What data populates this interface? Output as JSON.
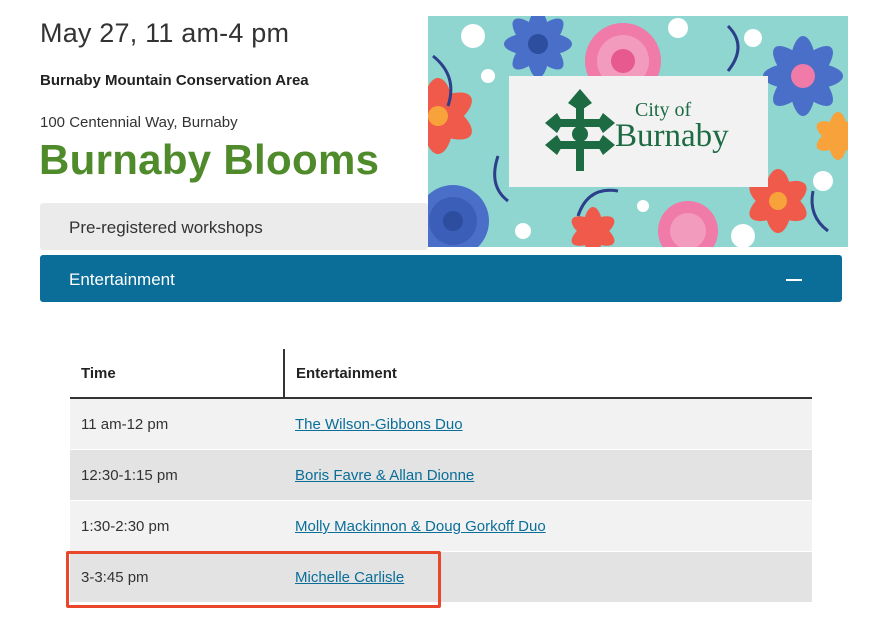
{
  "event": {
    "date": "May 27, 11 am-4 pm",
    "venue": "Burnaby Mountain Conservation Area",
    "address": "100 Centennial Way, Burnaby",
    "title": "Burnaby Blooms"
  },
  "hero": {
    "logo_line1": "City of",
    "logo_line2": "Burnaby",
    "logo_icon": "snowflake-tree-icon",
    "colors": {
      "background": "#8fd5d0",
      "logo_green": "#1d6b43"
    }
  },
  "accordion": [
    {
      "label": "Pre-registered workshops",
      "expanded": false
    },
    {
      "label": "Entertainment",
      "expanded": true,
      "toggle_icon": "minus-icon"
    }
  ],
  "schedule": {
    "headers": [
      "Time",
      "Entertainment"
    ],
    "rows": [
      {
        "time": "11 am-12 pm",
        "performer": "The Wilson-Gibbons Duo"
      },
      {
        "time": "12:30-1:15 pm",
        "performer": "Boris Favre & Allan Dionne"
      },
      {
        "time": "1:30-2:30 pm",
        "performer": "Molly Mackinnon & Doug Gorkoff Duo"
      },
      {
        "time": "3-3:45 pm",
        "performer": "Michelle Carlisle"
      }
    ]
  },
  "colors": {
    "title_green": "#4f8a2b",
    "accordion_active": "#0a6e99",
    "link": "#0a6e99",
    "highlight": "#e8472a"
  }
}
